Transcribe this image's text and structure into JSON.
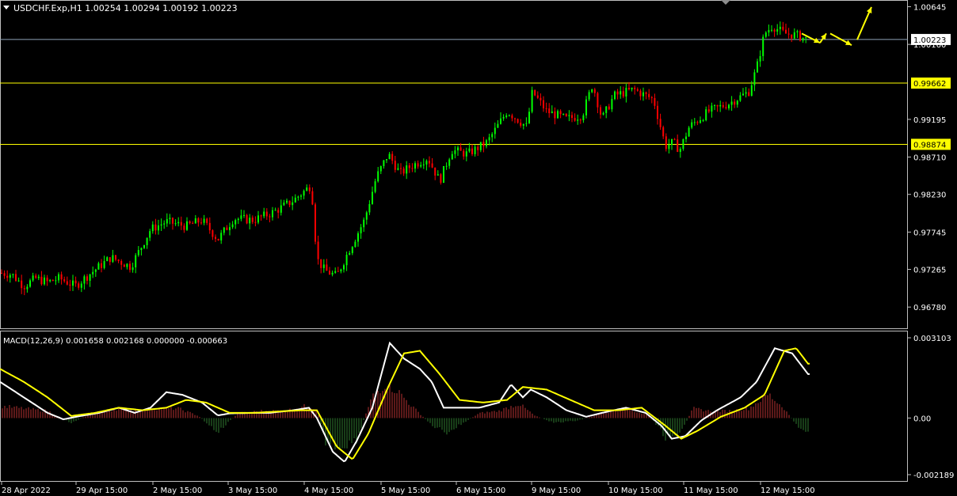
{
  "window": {
    "title": "USDCHF.Exp,H1",
    "ohlc": "1.00254 1.00294 1.00192 1.00223",
    "title_line": "USDCHF.Exp,H1  1.00254 1.00294 1.00192 1.00223"
  },
  "colors": {
    "background": "#000000",
    "bull_candle": "#00ff00",
    "bear_candle": "#ff0000",
    "level_line": "#ffff00",
    "price_line": "#8ea2b8",
    "macd_line": "#ffffff",
    "signal_line": "#ffff00",
    "hist_pos": "#b83232",
    "hist_neg": "#2f7a2f",
    "arrows": "#ffff00"
  },
  "chart_data": [
    {
      "type": "candlestick",
      "title": "USDCHF.Exp,H1",
      "y_ticks": [
        "1.00645",
        "1.00160",
        "0.99195",
        "0.98710",
        "0.98230",
        "0.97745",
        "0.97265",
        "0.96780"
      ],
      "ylim": [
        0.9668,
        1.0067
      ],
      "x_ticks": [
        "28 Apr 2022",
        "29 Apr 15:00",
        "2 May 15:00",
        "3 May 15:00",
        "4 May 15:00",
        "5 May 15:00",
        "6 May 15:00",
        "9 May 15:00",
        "10 May 15:00",
        "11 May 15:00",
        "12 May 15:00"
      ],
      "levels": [
        {
          "value": 0.99662,
          "label": "0.99662"
        },
        {
          "value": 0.98874,
          "label": "0.98874"
        }
      ],
      "current_price": {
        "value": 1.00223,
        "label": "1.00223"
      },
      "anchors": [
        [
          0,
          0.9722
        ],
        [
          15,
          0.972
        ],
        [
          30,
          0.9705
        ],
        [
          45,
          0.9715
        ],
        [
          60,
          0.971
        ],
        [
          75,
          0.9715
        ],
        [
          95,
          0.9705
        ],
        [
          115,
          0.9722
        ],
        [
          140,
          0.9742
        ],
        [
          165,
          0.973
        ],
        [
          190,
          0.9778
        ],
        [
          210,
          0.9788
        ],
        [
          235,
          0.9782
        ],
        [
          255,
          0.979
        ],
        [
          275,
          0.9765
        ],
        [
          295,
          0.9792
        ],
        [
          320,
          0.979
        ],
        [
          345,
          0.98
        ],
        [
          370,
          0.9815
        ],
        [
          393,
          0.9835
        ],
        [
          400,
          0.974
        ],
        [
          410,
          0.9725
        ],
        [
          425,
          0.9718
        ],
        [
          440,
          0.975
        ],
        [
          460,
          0.979
        ],
        [
          475,
          0.9845
        ],
        [
          490,
          0.9875
        ],
        [
          505,
          0.985
        ],
        [
          520,
          0.986
        ],
        [
          540,
          0.987
        ],
        [
          555,
          0.984
        ],
        [
          570,
          0.988
        ],
        [
          590,
          0.9875
        ],
        [
          615,
          0.989
        ],
        [
          640,
          0.993
        ],
        [
          665,
          0.991
        ],
        [
          672,
          0.9955
        ],
        [
          690,
          0.993
        ],
        [
          715,
          0.992
        ],
        [
          735,
          0.9925
        ],
        [
          748,
          0.9965
        ],
        [
          760,
          0.992
        ],
        [
          775,
          0.995
        ],
        [
          800,
          0.9958
        ],
        [
          825,
          0.9945
        ],
        [
          840,
          0.9885
        ],
        [
          850,
          0.989
        ],
        [
          858,
          0.988
        ],
        [
          870,
          0.991
        ],
        [
          895,
          0.993
        ],
        [
          920,
          0.994
        ],
        [
          945,
          0.9955
        ],
        [
          955,
          0.9985
        ],
        [
          965,
          1.003
        ],
        [
          975,
          1.004
        ],
        [
          990,
          1.003
        ],
        [
          1005,
          1.0028
        ],
        [
          1020,
          1.0022
        ]
      ],
      "arrows": [
        [
          [
            1012,
            1.003
          ],
          [
            1035,
            1.0018
          ]
        ],
        [
          [
            1035,
            1.0018
          ],
          [
            1043,
            1.003
          ]
        ],
        [
          [
            1048,
            1.003
          ],
          [
            1075,
            1.0015
          ]
        ],
        [
          [
            1082,
            1.0022
          ],
          [
            1100,
            1.0064
          ]
        ]
      ]
    },
    {
      "type": "line",
      "title": "MACD(12,26,9) 0.001658 0.002168 0.000000 -0.000663",
      "y_ticks": [
        "0.003103",
        "0.00",
        "-0.002189"
      ],
      "ylim": [
        -0.002189,
        0.003103
      ],
      "x_range": [
        0,
        1022
      ],
      "series": [
        {
          "name": "",
          "color": "#ffffff",
          "points": [
            [
              0,
              0.0014
            ],
            [
              30,
              0.0008
            ],
            [
              60,
              0.0002
            ],
            [
              80,
              -5e-05
            ],
            [
              100,
              7e-05
            ],
            [
              125,
              0.0002
            ],
            [
              150,
              0.0004
            ],
            [
              170,
              0.0002
            ],
            [
              190,
              0.0004
            ],
            [
              210,
              0.001
            ],
            [
              230,
              0.0009
            ],
            [
              255,
              0.0006
            ],
            [
              275,
              0.0001
            ],
            [
              290,
              0.00018
            ],
            [
              320,
              0.0002
            ],
            [
              340,
              0.0002
            ],
            [
              370,
              0.0003
            ],
            [
              390,
              0.0004
            ],
            [
              400,
              -0.0
            ],
            [
              420,
              -0.0013
            ],
            [
              435,
              -0.0017
            ],
            [
              450,
              -0.0009
            ],
            [
              470,
              0.0004
            ],
            [
              492,
              0.0029
            ],
            [
              510,
              0.0023
            ],
            [
              530,
              0.0019
            ],
            [
              545,
              0.0014
            ],
            [
              560,
              0.0004
            ],
            [
              585,
              0.0004
            ],
            [
              605,
              0.0004
            ],
            [
              630,
              0.0006
            ],
            [
              645,
              0.0013
            ],
            [
              660,
              0.0008
            ],
            [
              670,
              0.0011
            ],
            [
              690,
              0.0008
            ],
            [
              715,
              0.0003
            ],
            [
              740,
              5e-05
            ],
            [
              760,
              0.0002
            ],
            [
              790,
              0.0004
            ],
            [
              815,
              0.0002
            ],
            [
              835,
              -0.0003
            ],
            [
              848,
              -0.0008
            ],
            [
              865,
              -0.0007
            ],
            [
              885,
              -0.0001
            ],
            [
              905,
              0.0003
            ],
            [
              935,
              0.0008
            ],
            [
              955,
              0.0014
            ],
            [
              978,
              0.0027
            ],
            [
              1000,
              0.0025
            ],
            [
              1020,
              0.0017
            ]
          ]
        },
        {
          "name": "",
          "color": "#ffff00",
          "points": [
            [
              0,
              0.0019
            ],
            [
              30,
              0.0014
            ],
            [
              60,
              0.0008
            ],
            [
              90,
              8e-05
            ],
            [
              120,
              0.0002
            ],
            [
              150,
              0.0004
            ],
            [
              180,
              0.0003
            ],
            [
              210,
              0.0004
            ],
            [
              235,
              0.0007
            ],
            [
              260,
              0.0006
            ],
            [
              290,
              0.0002
            ],
            [
              320,
              0.0002
            ],
            [
              350,
              0.00025
            ],
            [
              380,
              0.0003
            ],
            [
              400,
              0.0003
            ],
            [
              425,
              -0.0011
            ],
            [
              445,
              -0.0016
            ],
            [
              465,
              -0.0006
            ],
            [
              490,
              0.0012
            ],
            [
              510,
              0.0025
            ],
            [
              530,
              0.0026
            ],
            [
              555,
              0.0017
            ],
            [
              580,
              0.0007
            ],
            [
              610,
              0.0006
            ],
            [
              640,
              0.0007
            ],
            [
              660,
              0.0012
            ],
            [
              690,
              0.0011
            ],
            [
              720,
              0.0007
            ],
            [
              750,
              0.0003
            ],
            [
              780,
              0.0003
            ],
            [
              810,
              0.0004
            ],
            [
              840,
              -0.0003
            ],
            [
              860,
              -0.0008
            ],
            [
              880,
              -0.0005
            ],
            [
              910,
              5e-05
            ],
            [
              940,
              0.0004
            ],
            [
              965,
              0.0009
            ],
            [
              990,
              0.0026
            ],
            [
              1005,
              0.0027
            ],
            [
              1020,
              0.0021
            ]
          ]
        }
      ],
      "histogram_anchors": [
        [
          0,
          0.0005
        ],
        [
          30,
          0.0004
        ],
        [
          60,
          0.0003
        ],
        [
          90,
          -0.0002
        ],
        [
          110,
          0.0001
        ],
        [
          150,
          0.0004
        ],
        [
          175,
          0.0003
        ],
        [
          200,
          0.0004
        ],
        [
          225,
          0.0004
        ],
        [
          250,
          0.0001
        ],
        [
          275,
          -0.0006
        ],
        [
          300,
          0.0002
        ],
        [
          330,
          0.0003
        ],
        [
          360,
          0.0003
        ],
        [
          385,
          0.0005
        ],
        [
          400,
          0.0004
        ],
        [
          410,
          -0.001
        ],
        [
          430,
          -0.0012
        ],
        [
          450,
          -0.0009
        ],
        [
          470,
          0.0009
        ],
        [
          485,
          0.0014
        ],
        [
          500,
          0.0012
        ],
        [
          520,
          0.0005
        ],
        [
          545,
          -0.0003
        ],
        [
          565,
          -0.0006
        ],
        [
          585,
          -0.0002
        ],
        [
          605,
          0.0002
        ],
        [
          630,
          0.0003
        ],
        [
          655,
          0.0006
        ],
        [
          675,
          0.0001
        ],
        [
          700,
          -0.0002
        ],
        [
          730,
          -0.0001
        ],
        [
          760,
          0.0002
        ],
        [
          790,
          0.0004
        ],
        [
          820,
          0.0001
        ],
        [
          840,
          -0.0008
        ],
        [
          855,
          -0.0009
        ],
        [
          875,
          0.0004
        ],
        [
          895,
          0.0003
        ],
        [
          920,
          0.0003
        ],
        [
          945,
          0.0004
        ],
        [
          970,
          0.001
        ],
        [
          990,
          0.0004
        ],
        [
          1005,
          -0.0003
        ],
        [
          1020,
          -0.0006
        ]
      ]
    }
  ]
}
